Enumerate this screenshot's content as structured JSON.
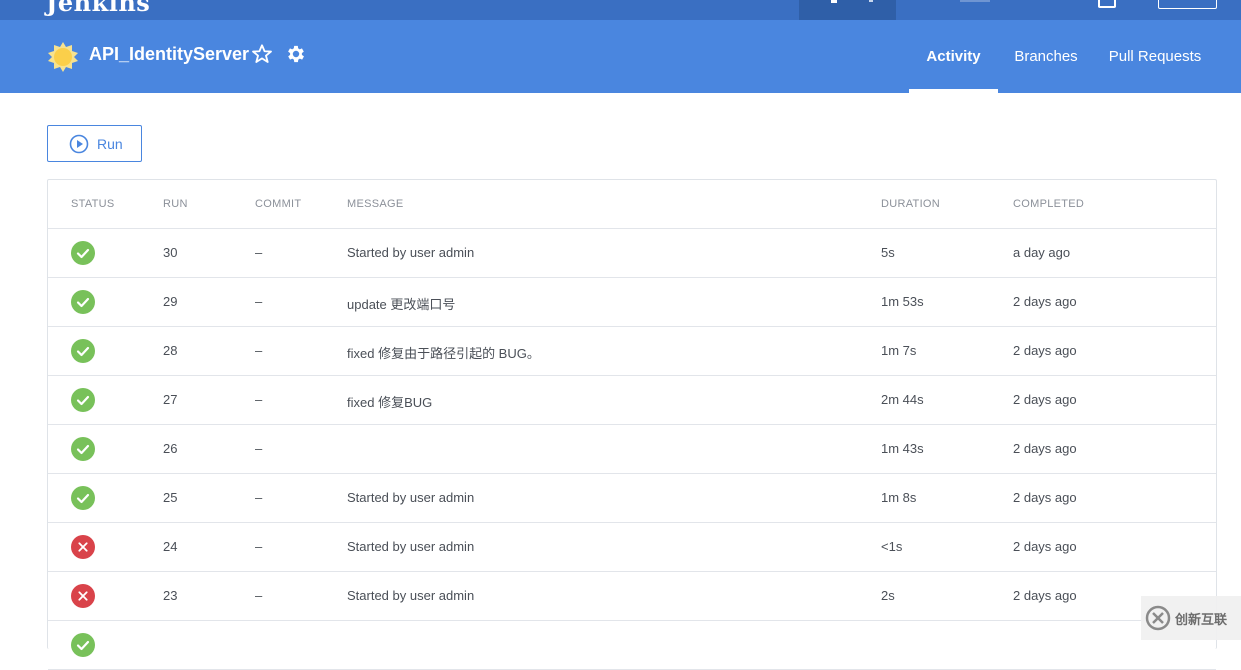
{
  "topbar": {
    "brand": "Jenkins"
  },
  "header": {
    "title": "API_IdentityServer",
    "tabs": [
      {
        "label": "Activity",
        "active": true
      },
      {
        "label": "Branches",
        "active": false
      },
      {
        "label": "Pull Requests",
        "active": false
      }
    ]
  },
  "toolbar": {
    "run_label": "Run"
  },
  "table": {
    "columns": [
      "STATUS",
      "RUN",
      "COMMIT",
      "MESSAGE",
      "DURATION",
      "COMPLETED"
    ],
    "rows": [
      {
        "status": "success",
        "run": "30",
        "commit": "–",
        "message": "Started by user admin",
        "duration": "5s",
        "completed": "a day ago"
      },
      {
        "status": "success",
        "run": "29",
        "commit": "–",
        "message": "update 更改端口号",
        "duration": "1m 53s",
        "completed": "2 days ago"
      },
      {
        "status": "success",
        "run": "28",
        "commit": "–",
        "message": "fixed 修复由于路径引起的 BUG。",
        "duration": "1m 7s",
        "completed": "2 days ago"
      },
      {
        "status": "success",
        "run": "27",
        "commit": "–",
        "message": "fixed 修复BUG",
        "duration": "2m 44s",
        "completed": "2 days ago"
      },
      {
        "status": "success",
        "run": "26",
        "commit": "–",
        "message": "",
        "duration": "1m 43s",
        "completed": "2 days ago"
      },
      {
        "status": "success",
        "run": "25",
        "commit": "–",
        "message": "Started by user admin",
        "duration": "1m 8s",
        "completed": "2 days ago"
      },
      {
        "status": "failure",
        "run": "24",
        "commit": "–",
        "message": "Started by user admin",
        "duration": "<1s",
        "completed": "2 days ago"
      },
      {
        "status": "failure",
        "run": "23",
        "commit": "–",
        "message": "Started by user admin",
        "duration": "2s",
        "completed": "2 days ago"
      },
      {
        "status": "success",
        "run": "",
        "commit": "",
        "message": "",
        "duration": "",
        "completed": ""
      }
    ]
  },
  "watermark": {
    "text": "创新互联"
  },
  "colors": {
    "header": "#4a86df",
    "success": "#78c15a",
    "failure": "#d9434a",
    "topbar": "#3a6fc2"
  },
  "icons": {
    "weather": "sun-icon",
    "favorite": "star-icon",
    "settings": "gear-icon",
    "run": "play-circle-icon"
  }
}
